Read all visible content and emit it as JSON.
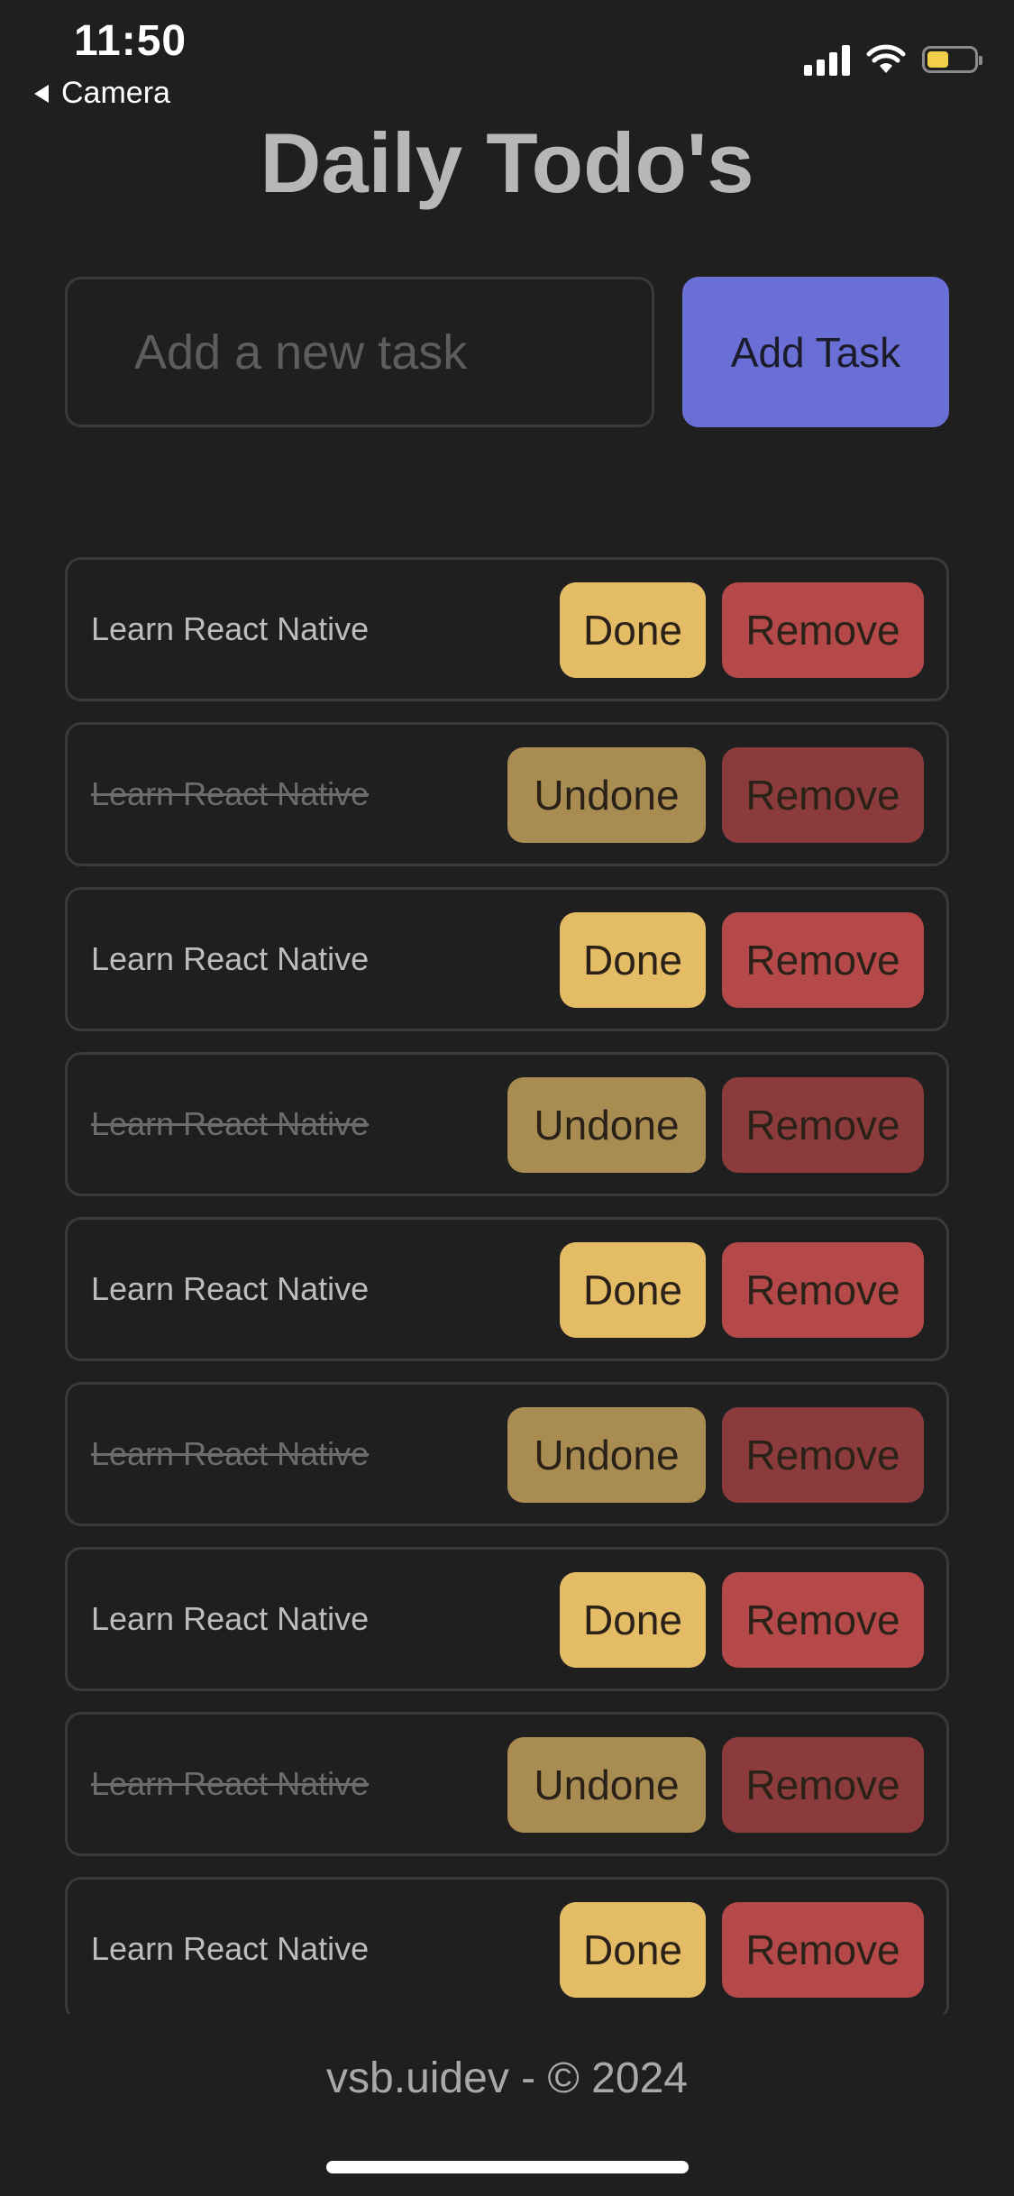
{
  "status_bar": {
    "time": "11:50",
    "back_label": "Camera",
    "icons": [
      "signal-icon",
      "wifi-icon",
      "battery-icon"
    ],
    "battery_color": "#f2cf49"
  },
  "app": {
    "title": "Daily Todo's"
  },
  "input": {
    "placeholder": "Add a new task",
    "value": ""
  },
  "add_button": {
    "label": "Add Task",
    "color": "#6a6fd6"
  },
  "tasks": [
    {
      "text": "Learn React Native",
      "done": false,
      "toggle_label": "Done",
      "remove_label": "Remove"
    },
    {
      "text": "Learn React Native",
      "done": true,
      "toggle_label": "Undone",
      "remove_label": "Remove"
    },
    {
      "text": "Learn React Native",
      "done": false,
      "toggle_label": "Done",
      "remove_label": "Remove"
    },
    {
      "text": "Learn React Native",
      "done": true,
      "toggle_label": "Undone",
      "remove_label": "Remove"
    },
    {
      "text": "Learn React Native",
      "done": false,
      "toggle_label": "Done",
      "remove_label": "Remove"
    },
    {
      "text": "Learn React Native",
      "done": true,
      "toggle_label": "Undone",
      "remove_label": "Remove"
    },
    {
      "text": "Learn React Native",
      "done": false,
      "toggle_label": "Done",
      "remove_label": "Remove"
    },
    {
      "text": "Learn React Native",
      "done": true,
      "toggle_label": "Undone",
      "remove_label": "Remove"
    },
    {
      "text": "Learn React Native",
      "done": false,
      "toggle_label": "Done",
      "remove_label": "Remove"
    }
  ],
  "colors": {
    "background": "#1f1f1f",
    "done_button": "#e4bc65",
    "undone_button": "#a88c52",
    "remove_button": "#b54949",
    "remove_button_dim": "#8b3b3b"
  },
  "footer": {
    "text": "vsb.uidev - © 2024"
  }
}
